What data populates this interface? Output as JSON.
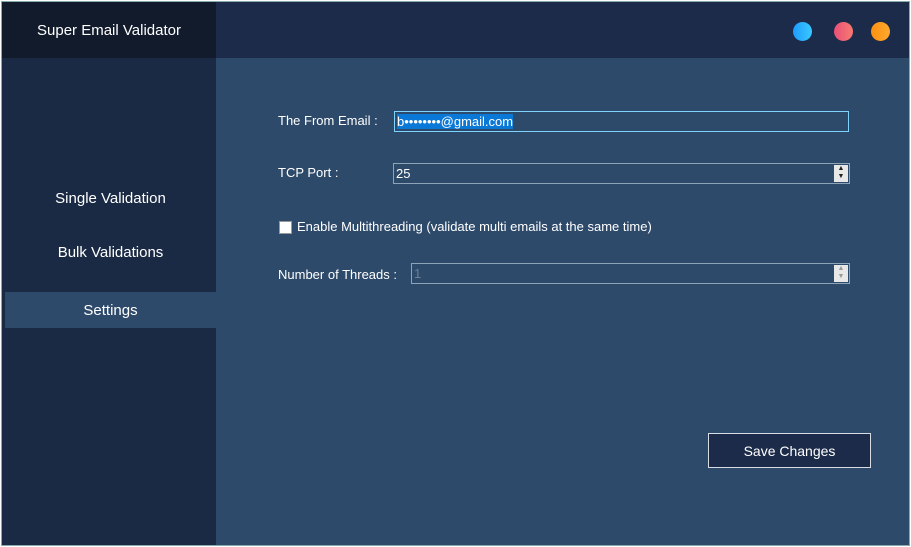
{
  "app": {
    "title": "Super Email Validator"
  },
  "window_dots": [
    {
      "name": "blue",
      "color": "#2aa8ff"
    },
    {
      "name": "red",
      "color": "#f0607a"
    },
    {
      "name": "orange",
      "color": "#ffa020"
    }
  ],
  "sidebar": {
    "items": [
      {
        "label": "Single Validation"
      },
      {
        "label": "Bulk Validations"
      },
      {
        "label": "Settings",
        "active": true
      }
    ]
  },
  "settings": {
    "from_email_label": "The From Email :",
    "from_email_value": "b••••••••@gmail.com",
    "tcp_port_label": "TCP Port :",
    "tcp_port_value": "25",
    "multithreading_label": "Enable Multithreading (validate multi emails at the same time)",
    "multithreading_checked": false,
    "threads_label": "Number of Threads :",
    "threads_value": "1",
    "save_label": "Save Changes"
  }
}
